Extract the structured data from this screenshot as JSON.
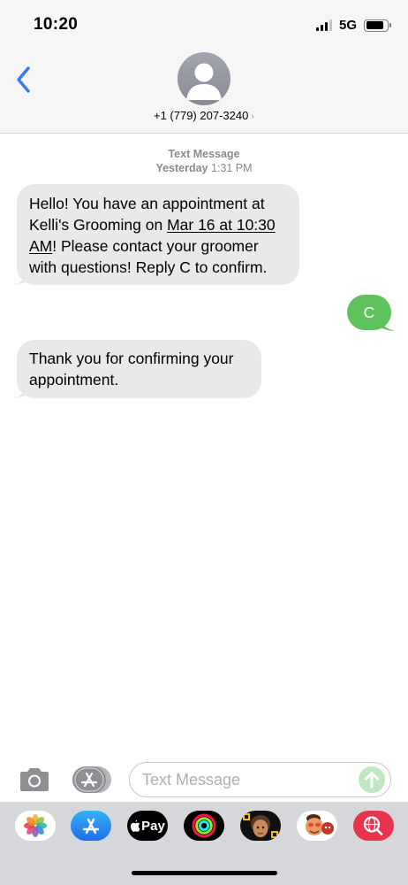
{
  "status_bar": {
    "time": "10:20",
    "network": "5G",
    "signal_bars": 3,
    "battery_level": 0.85
  },
  "header": {
    "back_icon": "chevron-left-icon",
    "avatar_icon": "person-silhouette-icon",
    "contact": "+1 (779) 207-3240",
    "chevron": "›"
  },
  "thread": {
    "service": "Text Message",
    "day": "Yesterday",
    "time": "1:31 PM"
  },
  "messages": [
    {
      "direction": "incoming",
      "line1": "Hello! You have an appointment at",
      "line2_prefix": "Kelli's Grooming on ",
      "link_part1": "Mar 16 at 10:30",
      "link_part2": "AM",
      "line3_suffix": "! Please contact your groomer",
      "line4": "with questions! Reply C to confirm."
    },
    {
      "direction": "outgoing",
      "text": "C"
    },
    {
      "direction": "incoming",
      "line1": "Thank you for confirming your",
      "line2": "appointment."
    }
  ],
  "input_bar": {
    "camera_icon": "camera-icon",
    "apps_icon": "app-store-icon",
    "placeholder": "Text Message",
    "value": "",
    "send_icon": "arrow-up-icon"
  },
  "app_drawer": {
    "apps": [
      {
        "name": "photos-app-icon"
      },
      {
        "name": "app-store-app-icon"
      },
      {
        "name": "apple-pay-app-icon",
        "label": "Pay"
      },
      {
        "name": "activity-app-icon"
      },
      {
        "name": "memoji-app-icon"
      },
      {
        "name": "animoji-app-icon"
      },
      {
        "name": "web-search-app-icon"
      }
    ]
  },
  "colors": {
    "incoming_bubble": "#e9e9eb",
    "outgoing_bubble": "#5fc25d",
    "accent_blue": "#3478f6",
    "send_button": "#bfe8c0",
    "header_bg": "#f6f6f6",
    "drawer_bg": "#d6d7db"
  }
}
